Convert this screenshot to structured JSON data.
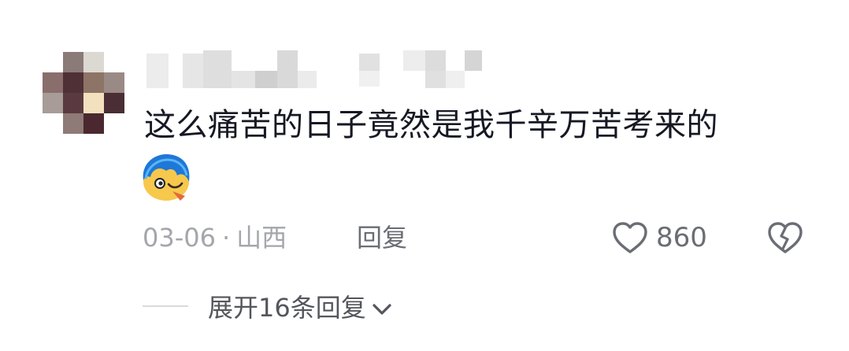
{
  "comment": {
    "text": "这么痛苦的日子竟然是我千辛万苦考来的",
    "date": "03-06",
    "separator": "·",
    "location": "山西",
    "reply_label": "回复",
    "like_count": "860"
  },
  "replies": {
    "expand_label": "展开16条回复"
  },
  "colors": {
    "text_primary": "#161823",
    "text_secondary": "#a4a6ab",
    "action_gray": "#6b6d75"
  }
}
